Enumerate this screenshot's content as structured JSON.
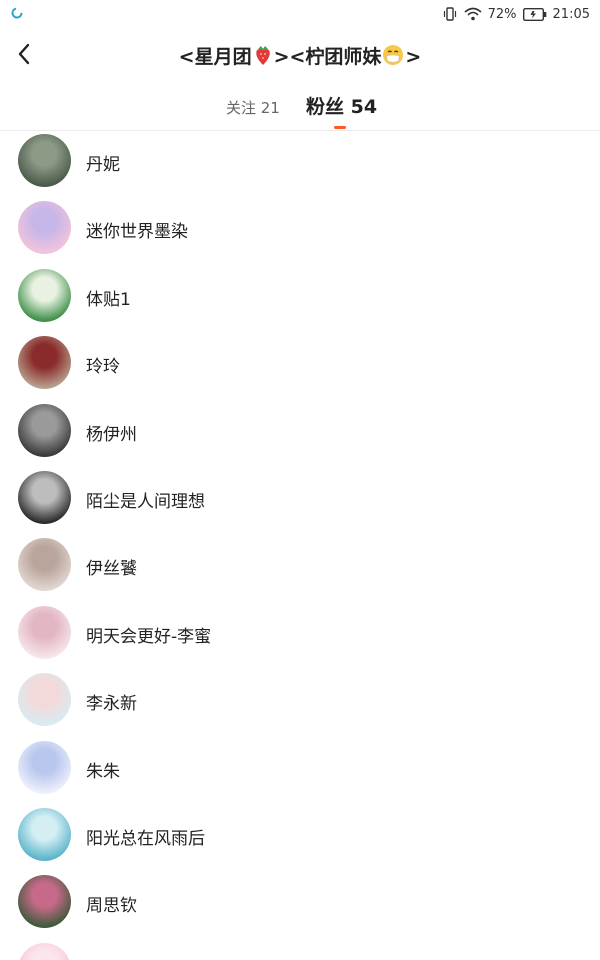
{
  "status_bar": {
    "battery": "72%",
    "time": "21:05"
  },
  "header": {
    "title_part1": "<星月团",
    "title_part2": "><柠团师妹",
    "title_part3": ">"
  },
  "tabs": {
    "following": "关注 21",
    "fans": "粉丝 54"
  },
  "fans": [
    {
      "name": "丹妮",
      "avatar_colors": [
        "#4a5a4a",
        "#8c9a86"
      ]
    },
    {
      "name": "迷你世界墨染",
      "avatar_colors": [
        "#f2c4dc",
        "#c7b6e8"
      ]
    },
    {
      "name": "体贴1",
      "avatar_colors": [
        "#3f8f4a",
        "#e9f2e2"
      ]
    },
    {
      "name": "玲玲",
      "avatar_colors": [
        "#b8a08e",
        "#8a2b2b"
      ]
    },
    {
      "name": "杨伊州",
      "avatar_colors": [
        "#3a3a3a",
        "#9a9a9a"
      ]
    },
    {
      "name": "陌尘是人间理想",
      "avatar_colors": [
        "#2a2a2a",
        "#bdbdbd"
      ]
    },
    {
      "name": "伊丝饕",
      "avatar_colors": [
        "#e2d6d2",
        "#b9a59c"
      ]
    },
    {
      "name": "明天会更好-李蜜",
      "avatar_colors": [
        "#f6e6ea",
        "#e3b6c4"
      ]
    },
    {
      "name": "李永新",
      "avatar_colors": [
        "#d8ebf2",
        "#f3d9d9"
      ]
    },
    {
      "name": "朱朱",
      "avatar_colors": [
        "#eef0fb",
        "#b9c7ee"
      ]
    },
    {
      "name": "阳光总在风雨后",
      "avatar_colors": [
        "#5ab4c9",
        "#d4eef4"
      ]
    },
    {
      "name": "周思钦",
      "avatar_colors": [
        "#3f5a3a",
        "#c76a8a"
      ]
    },
    {
      "name": "",
      "avatar_colors": [
        "#f4c8d8",
        "#fbe6ee"
      ]
    }
  ]
}
